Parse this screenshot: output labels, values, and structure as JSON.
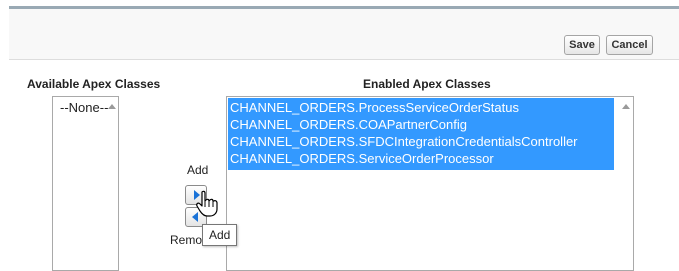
{
  "toolbar": {
    "save_label": "Save",
    "cancel_label": "Cancel"
  },
  "available": {
    "heading": "Available Apex Classes",
    "options": [
      "--None--"
    ]
  },
  "enabled": {
    "heading": "Enabled Apex Classes",
    "options": [
      "CHANNEL_ORDERS.ProcessServiceOrderStatus",
      "CHANNEL_ORDERS.COAPartnerConfig",
      "CHANNEL_ORDERS.SFDCIntegrationCredentialsController",
      "CHANNEL_ORDERS.ServiceOrderProcessor"
    ]
  },
  "controls": {
    "add_label": "Add",
    "remove_label": "Remove",
    "tooltip": "Add"
  },
  "colors": {
    "selection": "#3399ff",
    "arrow": "#1a73d8",
    "top_border": "#99a9b4"
  },
  "icons": {
    "add": "arrow-right-icon",
    "remove": "arrow-left-icon",
    "cursor": "hand-pointer-icon"
  }
}
